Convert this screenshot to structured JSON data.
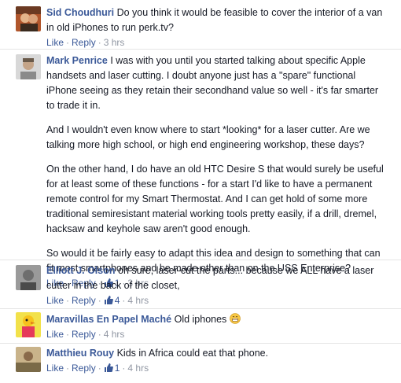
{
  "comments": [
    {
      "author": "Sid Choudhuri",
      "paragraphs": [
        "Do you think it would be feasible to cover the interior of a van in old iPhones to run perk.tv?"
      ],
      "like_label": "Like",
      "reply_label": "Reply",
      "time": "3 hrs",
      "likes": ""
    },
    {
      "author": "Mark Penrice",
      "paragraphs": [
        "I was with you until you started talking about specific Apple handsets and laser cutting. I doubt anyone just has a \"spare\" functional iPhone seeing as they retain their secondhand value so well - it's far smarter to trade it in.",
        "And I wouldn't even know where to start *looking* for a laser cutter. Are we talking more high school, or high end engineering workshop, these days?",
        "On the other hand, I do have an old HTC Desire S that would surely be useful for at least some of these functions - for a start I'd like to have a permanent remote control for my Smart Thermostat. And I can get hold of some more traditional semiresistant material working tools pretty easily, if a drill, dremel, hacksaw and keyhole saw aren't good enough.",
        "So would it be fairly easy to adapt this idea and design to something that can fit most smartphones and be made other than on the USS Enterprise?"
      ],
      "like_label": "Like",
      "reply_label": "Reply",
      "time": "3 hrs",
      "likes": "1"
    },
    {
      "author": "Elliott J. Olson",
      "paragraphs": [
        "oh sure, laser-cut the parts... because we ALL have a laser cutter in the back of the closet,"
      ],
      "like_label": "Like",
      "reply_label": "Reply",
      "time": "4 hrs",
      "likes": "4"
    },
    {
      "author": "Maravillas En Papel Maché",
      "paragraphs": [
        "Old iphones"
      ],
      "like_label": "Like",
      "reply_label": "Reply",
      "time": "4 hrs",
      "likes": ""
    },
    {
      "author": "Matthieu Rouy",
      "paragraphs": [
        "Kids in Africa could eat that phone."
      ],
      "like_label": "Like",
      "reply_label": "Reply",
      "time": "4 hrs",
      "likes": "1"
    }
  ]
}
